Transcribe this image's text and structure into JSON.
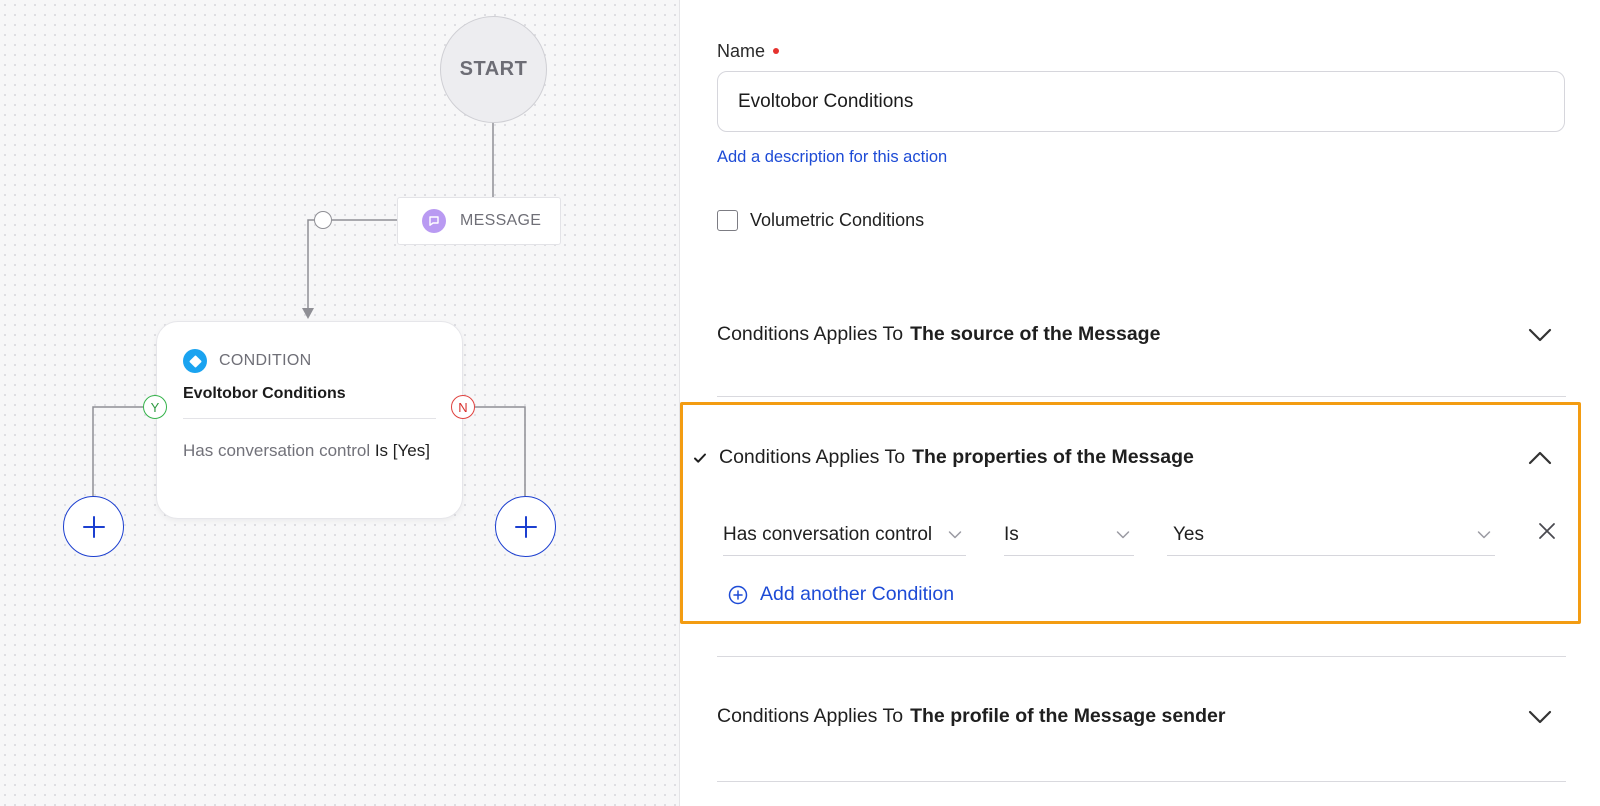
{
  "canvas": {
    "start_label": "START",
    "message_label": "MESSAGE",
    "condition": {
      "type_label": "CONDITION",
      "name": "Evoltobor Conditions",
      "summary_field": "Has conversation control",
      "summary_op": "Is",
      "summary_value": "[Yes]"
    },
    "branch_yes": "Y",
    "branch_no": "N",
    "add_symbol": "+"
  },
  "panel": {
    "name_label": "Name",
    "name_value": "Evoltobor Conditions",
    "add_description_link": "Add a description for this action",
    "volumetric_label": "Volumetric Conditions",
    "sections": [
      {
        "prefix": "Conditions Applies To",
        "target": "The source of the Message",
        "expanded": false
      },
      {
        "prefix": "Conditions Applies To",
        "target": "The properties of the Message",
        "expanded": true,
        "completed": true
      },
      {
        "prefix": "Conditions Applies To",
        "target": "The profile of the Message sender",
        "expanded": false
      }
    ],
    "condition_row": {
      "field": "Has conversation control",
      "operator": "Is",
      "value": "Yes"
    },
    "add_condition_label": "Add another Condition"
  },
  "colors": {
    "accent_blue": "#1d4bd6",
    "highlight_orange": "#f39c12",
    "yes_green": "#34b34a",
    "no_red": "#e0413e",
    "message_purple": "#b99af2",
    "condition_blue": "#1aa3f0"
  },
  "icons": {
    "message": "chat-bubble-icon",
    "condition": "diamond-icon",
    "add_node": "plus-icon",
    "expand": "chevron-down-icon",
    "collapse": "chevron-up-icon",
    "dropdown": "chevron-down-icon",
    "remove": "close-icon",
    "add_condition": "plus-circle-icon",
    "completed": "checkmark-icon"
  }
}
